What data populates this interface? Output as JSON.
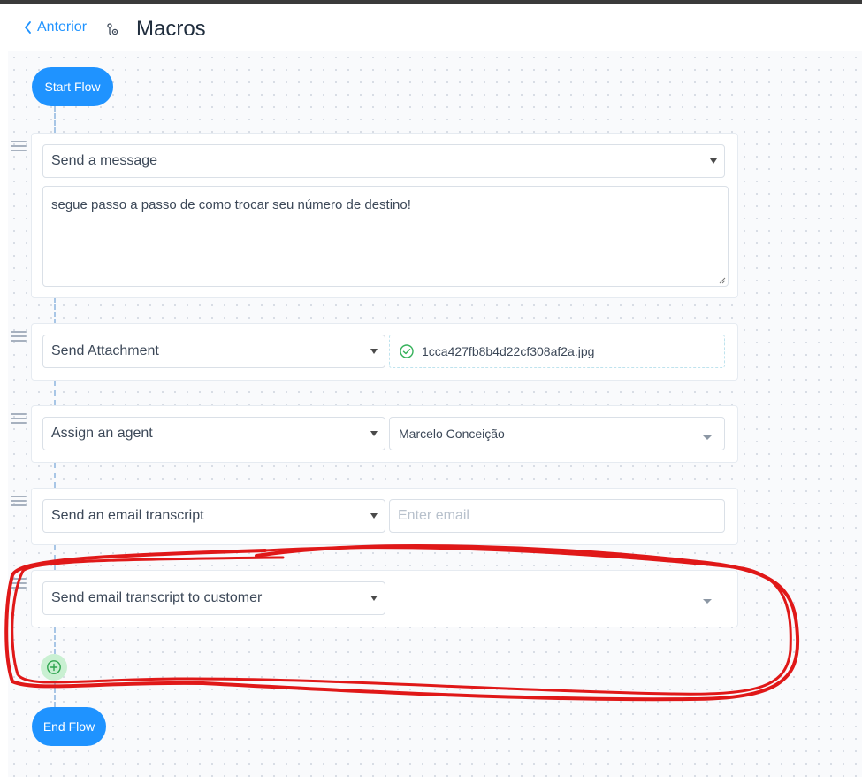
{
  "header": {
    "back_label": "Anterior",
    "title": "Macros"
  },
  "flow": {
    "start_label": "Start Flow",
    "end_label": "End Flow",
    "actions": [
      {
        "type": "Send a message",
        "message": "segue passo a passo de como trocar seu número de destino!"
      },
      {
        "type": "Send Attachment",
        "attachment_name": "1cca427fb8b4d22cf308af2a.jpg"
      },
      {
        "type": "Assign an agent",
        "agent": "Marcelo Conceição"
      },
      {
        "type": "Send an email transcript",
        "email_value": "",
        "email_placeholder": "Enter email"
      },
      {
        "type": "Send email transcript to customer"
      }
    ]
  },
  "colors": {
    "accent": "#1f93ff",
    "annotation": "#e01818",
    "add_button_bg": "#c9f0d2",
    "add_button_icon": "#2da44e"
  },
  "icons": {
    "back": "chevron-left-icon",
    "header": "macro-icon",
    "drag": "drag-handle-icon",
    "attachment_status": "check-circle-icon",
    "add": "plus-circle-icon"
  }
}
